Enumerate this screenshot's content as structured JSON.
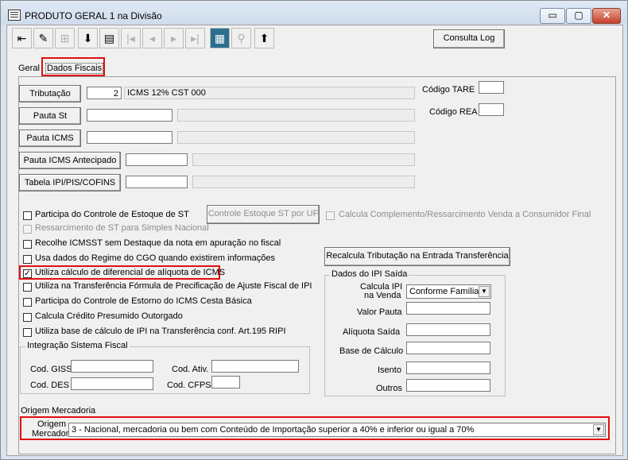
{
  "window": {
    "title": "PRODUTO GERAL 1 na Divisão",
    "minimize": "▭",
    "maximize": "▢",
    "close": "✕"
  },
  "toolbar": {
    "consulta_log": "Consulta Log",
    "icons": [
      "exit-icon",
      "edit-icon",
      "tree-icon",
      "save-icon",
      "print-icon",
      "first-icon",
      "prev-icon",
      "next-icon",
      "last-icon",
      "grid-icon",
      "find-icon",
      "import-icon"
    ]
  },
  "tabs": {
    "geral": "Geral",
    "dados_fiscais": "Dados Fiscais"
  },
  "tributacao": {
    "button": "Tributação",
    "code": "2",
    "desc": "ICMS 12% CST 000"
  },
  "pauta_st": {
    "button": "Pauta St",
    "code": "",
    "desc": ""
  },
  "pauta_icms": {
    "button": "Pauta ICMS",
    "code": "",
    "desc": ""
  },
  "pauta_icms_antecipado": {
    "button": "Pauta ICMS Antecipado",
    "code": "",
    "desc": ""
  },
  "tabela_ipi": {
    "button": "Tabela IPI/PIS/COFINS",
    "code": "",
    "desc": ""
  },
  "codigo_tare": {
    "label": "Código TARE",
    "value": ""
  },
  "codigo_rea": {
    "label": "Código REA",
    "value": ""
  },
  "checkboxes": [
    {
      "label": "Participa do Controle de Estoque de ST",
      "checked": false,
      "enabled": true
    },
    {
      "label": "Ressarcimento de ST para Simples Nacional",
      "checked": false,
      "enabled": false
    },
    {
      "label": "Recolhe ICMSST sem Destaque da nota em apuração no fiscal",
      "checked": false,
      "enabled": true
    },
    {
      "label": "Usa dados do Regime do CGO quando existirem informações",
      "checked": false,
      "enabled": true
    },
    {
      "label": "Utiliza cálculo de diferencial de alíquota de ICMS",
      "checked": true,
      "enabled": true
    },
    {
      "label": "Utiliza na Transferência  Fórmula de Precificação de Ajuste Fiscal de IPI",
      "checked": false,
      "enabled": true
    },
    {
      "label": "Participa do Controle de Estorno do ICMS Cesta Básica",
      "checked": false,
      "enabled": true
    },
    {
      "label": "Calcula Crédito Presumido Outorgado",
      "checked": false,
      "enabled": true
    },
    {
      "label": "Utiliza base de cálculo de IPI na Transferência conf. Art.195 RIPI",
      "checked": false,
      "enabled": true
    }
  ],
  "controle_estoque_st": "Controle Estoque ST por UF",
  "calcula_complemento": "Calcula Complemento/Ressarcimento Venda a Consumidor Final",
  "recalcula": "Recalcula Tributação na Entrada Transferência",
  "integracao": {
    "title": "Integração Sistema Fiscal",
    "cod_giss": "Cod. GISS",
    "cod_des": "Cod. DES",
    "cod_ativ": "Cod. Ativ.",
    "cod_cfps": "Cod. CFPS"
  },
  "ipi_saida": {
    "title": "Dados do IPI Saída",
    "calcula_ipi_1": "Calcula IPI",
    "calcula_ipi_2": "na Venda",
    "calcula_value": "Conforme Família",
    "valor_pauta": "Valor Pauta",
    "aliquota_saida": "Alíquota Saída",
    "base_calculo": "Base de Cálculo",
    "isento": "Isento",
    "outros": "Outros"
  },
  "origem": {
    "group_title": "Origem Mercadoria",
    "label_1": "Origem",
    "label_2": "Mercadoria",
    "value": "3 - Nacional, mercadoria ou bem com Conteúdo de Importação superior a 40% e inferior ou igual a 70%"
  },
  "colors": {
    "highlight": "#e01010",
    "title_bg": "#cfdcec"
  }
}
